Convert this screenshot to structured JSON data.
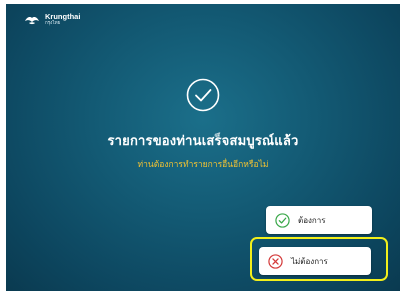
{
  "brand": {
    "name": "Krungthai",
    "subname": "กรุงไทย",
    "logo_icon": "krungthai-bird-logo"
  },
  "status": {
    "icon": "check-circle-icon",
    "title": "รายการของท่านเสร็จสมบูรณ์แล้ว",
    "question": "ท่านต้องการทำรายการอื่นอีกหรือไม่"
  },
  "buttons": {
    "yes": {
      "label": "ต้องการ",
      "icon": "check-circle-icon"
    },
    "no": {
      "label": "ไม่ต้องการ",
      "icon": "x-circle-icon"
    }
  },
  "colors": {
    "background": "#135a74",
    "question_text": "#f3c332",
    "yes_icon": "#3aa84a",
    "no_icon": "#d43a3a",
    "highlight": "#f2ef1b"
  }
}
